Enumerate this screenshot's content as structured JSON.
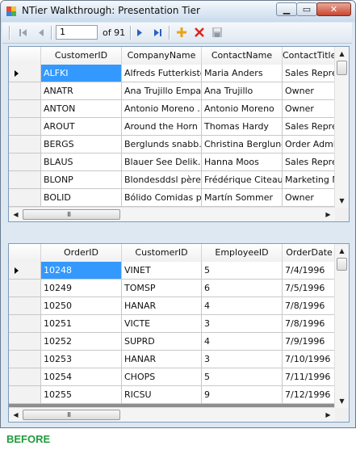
{
  "window": {
    "title": "NTier Walkthrough: Presentation Tier"
  },
  "toolbar": {
    "position_value": "1",
    "count_text": "of 91"
  },
  "customers_grid": {
    "columns": [
      "CustomerID",
      "CompanyName",
      "ContactName",
      "ContactTitle"
    ],
    "rows": [
      [
        "ALFKI",
        "Alfreds Futterkiste",
        "Maria Anders",
        "Sales Repres"
      ],
      [
        "ANATR",
        "Ana Trujillo Empa...",
        "Ana Trujillo",
        "Owner"
      ],
      [
        "ANTON",
        "Antonio Moreno ...",
        "Antonio Moreno",
        "Owner"
      ],
      [
        "AROUT",
        "Around the Horn",
        "Thomas Hardy",
        "Sales Repres"
      ],
      [
        "BERGS",
        "Berglunds snabb...",
        "Christina Berglund",
        "Order Adminis"
      ],
      [
        "BLAUS",
        "Blauer See Delik...",
        "Hanna Moos",
        "Sales Repres"
      ],
      [
        "BLONP",
        "Blondesddsl père...",
        "Frédérique Citeaux",
        "Marketing Ma"
      ],
      [
        "BOLID",
        "Bólido Comidas p...",
        "Martín Sommer",
        "Owner"
      ]
    ]
  },
  "orders_grid": {
    "columns": [
      "OrderID",
      "CustomerID",
      "EmployeeID",
      "OrderDate"
    ],
    "rows": [
      [
        "10248",
        "VINET",
        "5",
        "7/4/1996"
      ],
      [
        "10249",
        "TOMSP",
        "6",
        "7/5/1996"
      ],
      [
        "10250",
        "HANAR",
        "4",
        "7/8/1996"
      ],
      [
        "10251",
        "VICTE",
        "3",
        "7/8/1996"
      ],
      [
        "10252",
        "SUPRD",
        "4",
        "7/9/1996"
      ],
      [
        "10253",
        "HANAR",
        "3",
        "7/10/1996"
      ],
      [
        "10254",
        "CHOPS",
        "5",
        "7/11/1996"
      ],
      [
        "10255",
        "RICSU",
        "9",
        "7/12/1996"
      ]
    ]
  },
  "caption": "BEFORE",
  "colors": {
    "selection": "#3399ff",
    "caption": "#1f9c3a",
    "add_icon": "#e8a317",
    "delete_icon": "#d9261c",
    "nav_icon": "#2a5fc4"
  },
  "icons": [
    "app-icon",
    "move-first-icon",
    "move-previous-icon",
    "move-next-icon",
    "move-last-icon",
    "add-new-icon",
    "delete-icon",
    "save-icon"
  ]
}
